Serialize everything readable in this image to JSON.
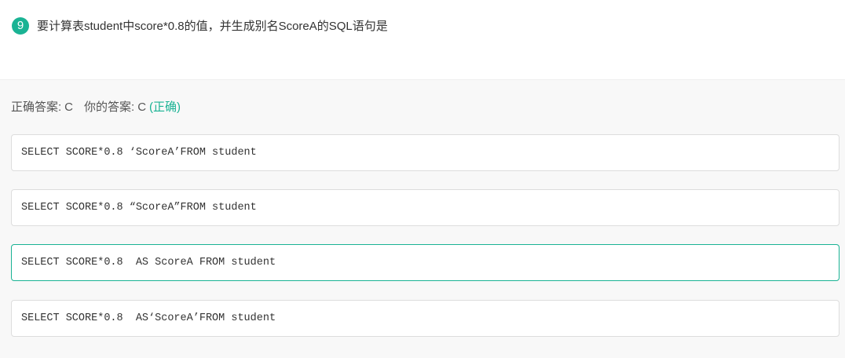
{
  "question": {
    "number": "9",
    "text": "要计算表student中score*0.8的值，并生成别名ScoreA的SQL语句是"
  },
  "answer": {
    "correct_label": "正确答案:",
    "correct_value": "C",
    "your_label": "你的答案:",
    "your_value": "C",
    "result": "(正确)"
  },
  "options": [
    {
      "text": "SELECT SCORE*0.8 ‘ScoreA’FROM student"
    },
    {
      "text": "SELECT SCORE*0.8 “ScoreA”FROM student"
    },
    {
      "text": "SELECT SCORE*0.8  AS ScoreA FROM student"
    },
    {
      "text": "SELECT SCORE*0.8  AS‘ScoreA’FROM student"
    }
  ],
  "colors": {
    "accent": "#1ab394",
    "option_border": "#dddddd",
    "panel_background": "#f8f8f8"
  }
}
